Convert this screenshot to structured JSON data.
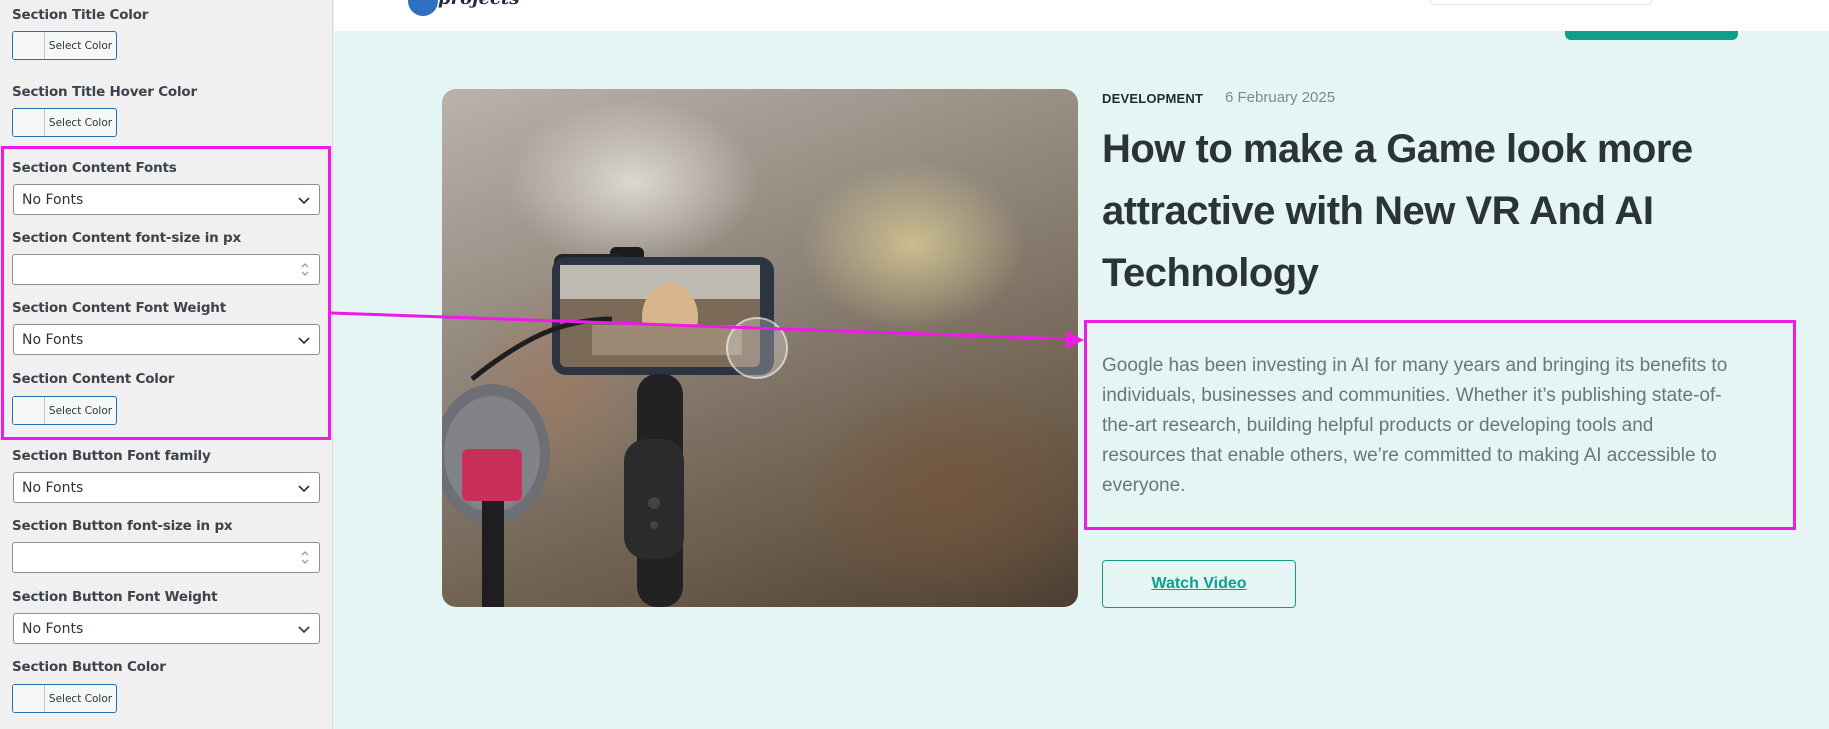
{
  "customizer": {
    "fields": [
      {
        "label": "Section Title Color",
        "control": "color",
        "button_label": "Select Color"
      },
      {
        "label": "Section Title Hover Color",
        "control": "color",
        "button_label": "Select Color"
      },
      {
        "label": "Section Content Fonts",
        "control": "select",
        "value": "No Fonts"
      },
      {
        "label": "Section Content font-size in px",
        "control": "number",
        "value": ""
      },
      {
        "label": "Section Content Font Weight",
        "control": "select",
        "value": "No Fonts"
      },
      {
        "label": "Section Content Color",
        "control": "color",
        "button_label": "Select Color"
      },
      {
        "label": "Section Button Font family",
        "control": "select",
        "value": "No Fonts"
      },
      {
        "label": "Section Button font-size in px",
        "control": "number",
        "value": ""
      },
      {
        "label": "Section Button Font Weight",
        "control": "select",
        "value": "No Fonts"
      },
      {
        "label": "Section Button Color",
        "control": "color",
        "button_label": "Select Color"
      }
    ]
  },
  "site": {
    "logo_text": "projects",
    "brand_color": "#0f9e8e"
  },
  "post": {
    "category": "DEVELOPMENT",
    "date": "6 February 2025",
    "title": "How to make a Game look more attractive with New VR And AI Technology",
    "excerpt": "Google has been investing in AI for many years and bringing its benefits to individuals, businesses and communities. Whether it’s publishing state-of-the-art research, building helpful products or developing tools and resources that enable others, we’re committed to making AI accessible to everyone.",
    "button_label": "Watch Video"
  },
  "annotation": {
    "color": "#ee1be6"
  },
  "icons": {
    "select_arrow": "chevron-down-icon",
    "number_spinner": "spinner-arrows-icon",
    "logo": "logo-mark-icon"
  }
}
